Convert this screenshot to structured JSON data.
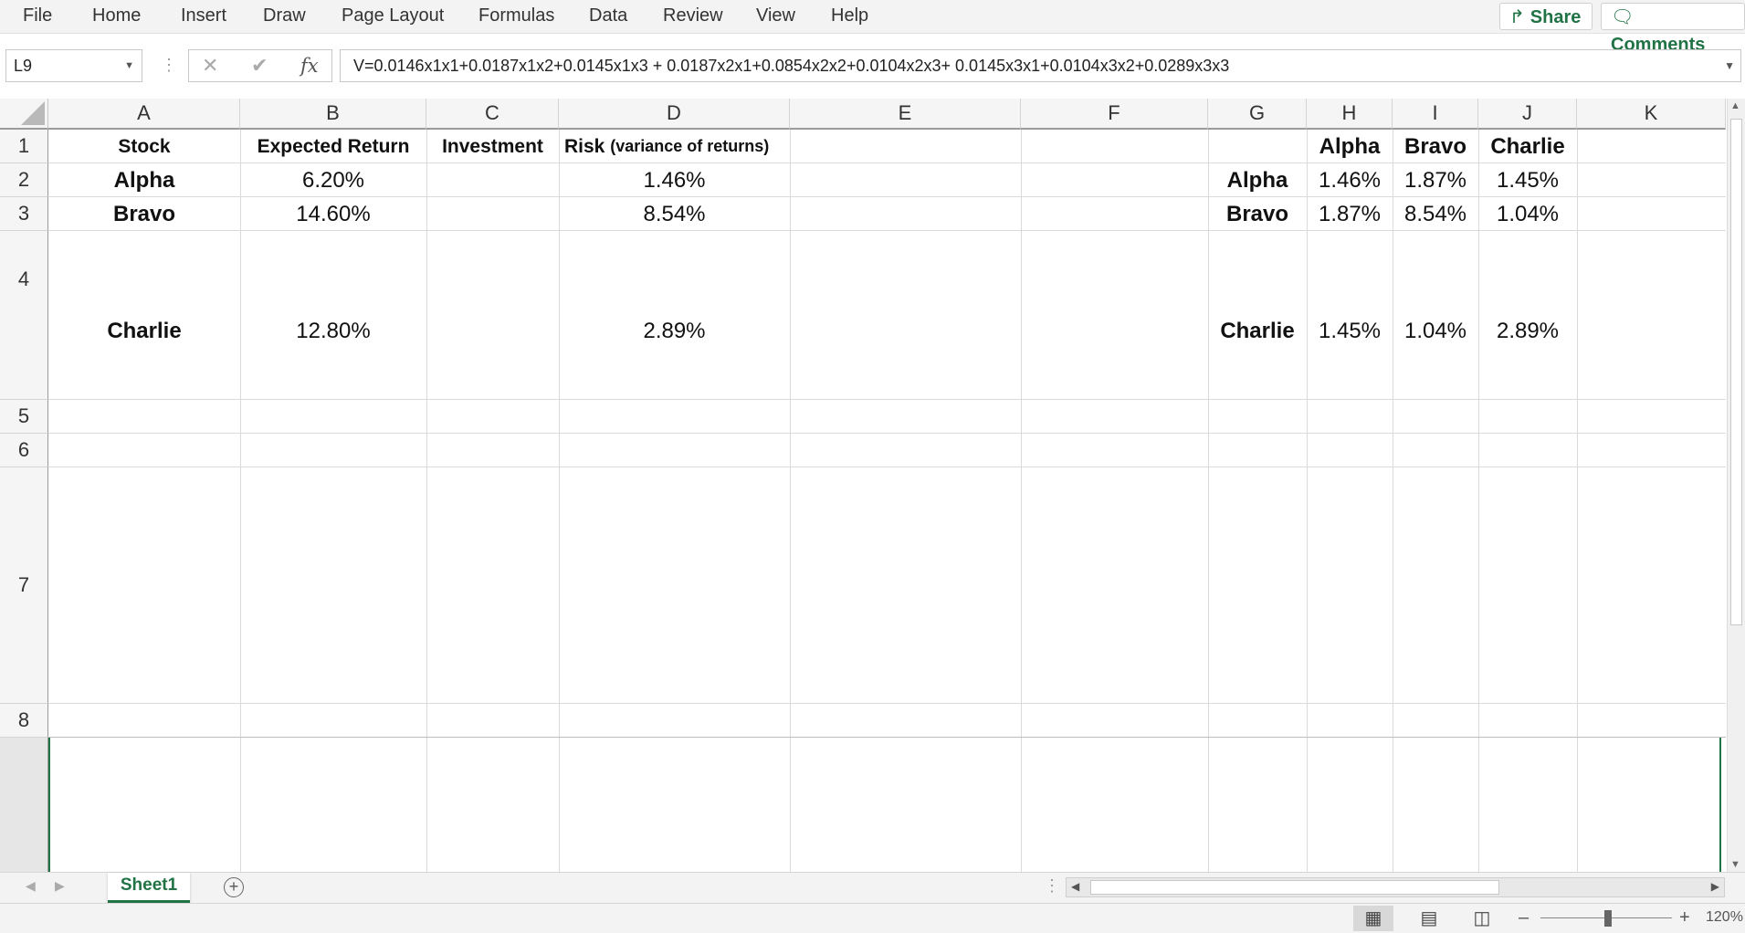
{
  "ribbon": {
    "tabs": [
      "File",
      "Home",
      "Insert",
      "Draw",
      "Page Layout",
      "Formulas",
      "Data",
      "Review",
      "View",
      "Help"
    ],
    "share_label": "Share",
    "comments_label": "Comments"
  },
  "formula_bar": {
    "name_box": "L9",
    "formula": "V=0.0146x1x1+0.0187x1x2+0.0145x1x3 + 0.0187x2x1+0.0854x2x2+0.0104x2x3+ 0.0145x3x1+0.0104x3x2+0.0289x3x3"
  },
  "columns": [
    "A",
    "B",
    "C",
    "D",
    "E",
    "F",
    "G",
    "H",
    "I",
    "J",
    "K"
  ],
  "rows": [
    "1",
    "2",
    "3",
    "4",
    "5",
    "6",
    "7",
    "8"
  ],
  "table": {
    "headers": {
      "stock": "Stock",
      "expected_return": "Expected Return",
      "investment": "Investment",
      "risk": "Risk",
      "risk_note": "(variance of returns)"
    },
    "rows": [
      {
        "stock": "Alpha",
        "expected_return": "6.20%",
        "investment": "",
        "risk": "1.46%"
      },
      {
        "stock": "Bravo",
        "expected_return": "14.60%",
        "investment": "",
        "risk": "8.54%"
      },
      {
        "stock": "Charlie",
        "expected_return": "12.80%",
        "investment": "",
        "risk": "2.89%"
      }
    ]
  },
  "covariance": {
    "col_headers": [
      "Alpha",
      "Bravo",
      "Charlie"
    ],
    "row_headers": [
      "Alpha",
      "Bravo",
      "Charlie"
    ],
    "values": [
      [
        "1.46%",
        "1.87%",
        "1.45%"
      ],
      [
        "1.87%",
        "8.54%",
        "1.04%"
      ],
      [
        "1.45%",
        "1.04%",
        "2.89%"
      ]
    ]
  },
  "sheets": {
    "active": "Sheet1"
  },
  "status_bar": {
    "zoom": "120%",
    "zoom_level": 0.5
  }
}
